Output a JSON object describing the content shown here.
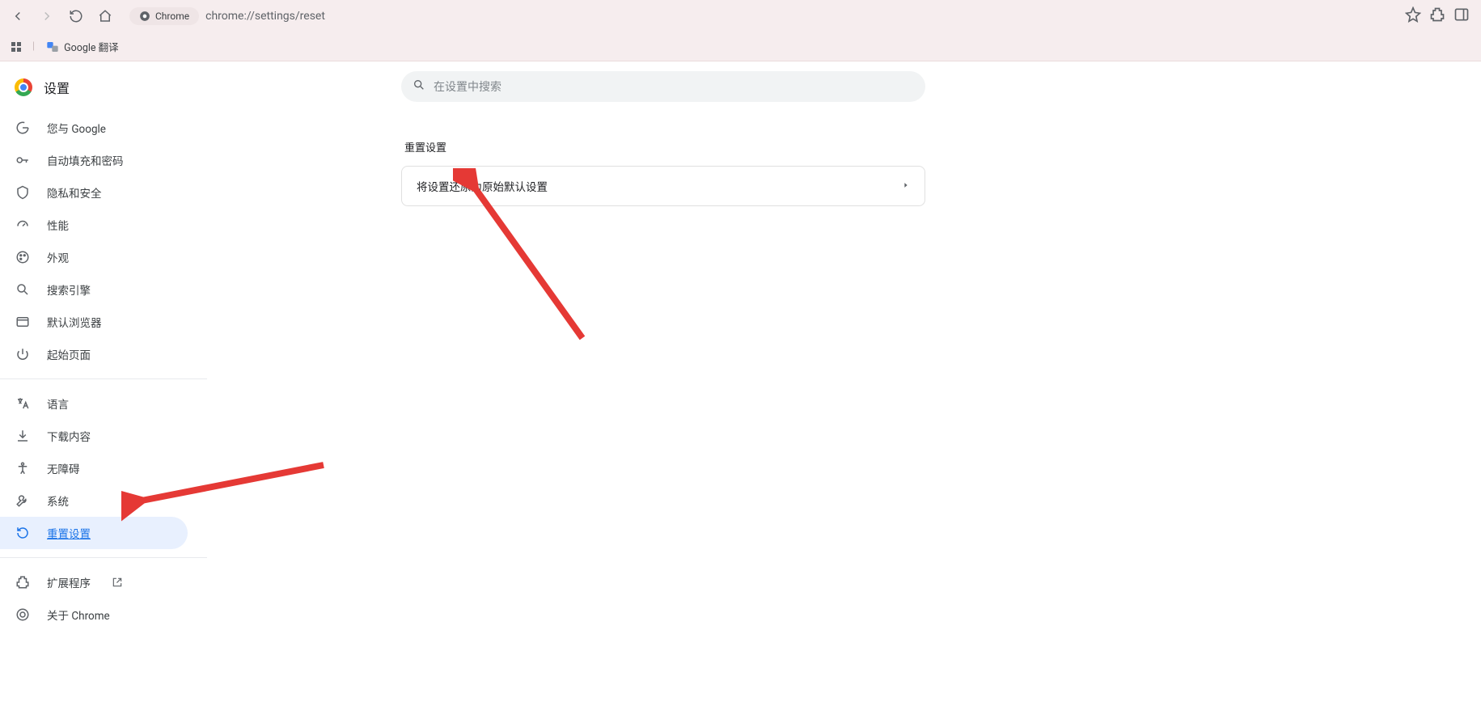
{
  "browser": {
    "chip_label": "Chrome",
    "url": "chrome://settings/reset"
  },
  "bookmarks": {
    "translate_label": "Google 翻译"
  },
  "sidebar": {
    "title": "设置",
    "items_a": [
      {
        "label": "您与 Google"
      },
      {
        "label": "自动填充和密码"
      },
      {
        "label": "隐私和安全"
      },
      {
        "label": "性能"
      },
      {
        "label": "外观"
      },
      {
        "label": "搜索引擎"
      },
      {
        "label": "默认浏览器"
      },
      {
        "label": "起始页面"
      }
    ],
    "items_b": [
      {
        "label": "语言"
      },
      {
        "label": "下载内容"
      },
      {
        "label": "无障碍"
      },
      {
        "label": "系统"
      },
      {
        "label": "重置设置"
      }
    ],
    "items_c": [
      {
        "label": "扩展程序"
      },
      {
        "label": "关于 Chrome"
      }
    ]
  },
  "main": {
    "search_placeholder": "在设置中搜索",
    "section_heading": "重置设置",
    "reset_row_label": "将设置还原为原始默认设置"
  }
}
